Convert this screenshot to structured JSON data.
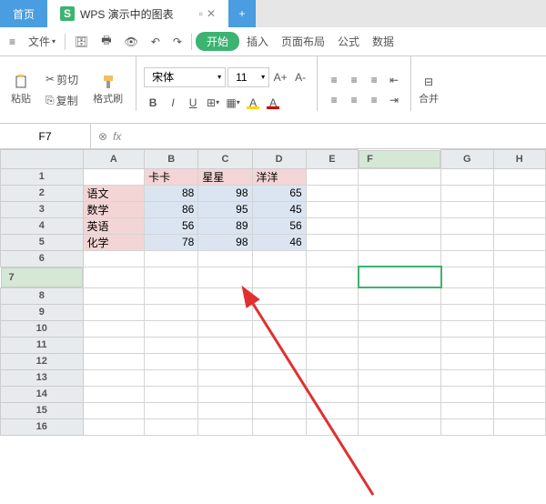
{
  "tabs": {
    "home": "首页",
    "badge": "S",
    "doc": "WPS 演示中的图表",
    "plus": "+"
  },
  "menu": {
    "file": "文件",
    "start": "开始",
    "insert": "插入",
    "layout": "页面布局",
    "formula": "公式",
    "data": "数据",
    "merge": "合并"
  },
  "clipboard": {
    "paste": "粘贴",
    "cut": "剪切",
    "copy": "复制",
    "format": "格式刷"
  },
  "font": {
    "name": "宋体",
    "size": "11",
    "bold": "B",
    "italic": "I",
    "underline": "U"
  },
  "namebox": {
    "ref": "F7",
    "fx": "fx"
  },
  "cols": [
    "A",
    "B",
    "C",
    "D",
    "E",
    "F",
    "G",
    "H"
  ],
  "rows": [
    "1",
    "2",
    "3",
    "4",
    "5",
    "6",
    "7",
    "8",
    "9",
    "10",
    "11",
    "12",
    "13",
    "14",
    "15",
    "16"
  ],
  "data": {
    "headers": [
      "卡卡",
      "星星",
      "洋洋"
    ],
    "rowlabels": [
      "语文",
      "数学",
      "英语",
      "化学"
    ],
    "values": [
      [
        88,
        98,
        65
      ],
      [
        86,
        95,
        45
      ],
      [
        56,
        89,
        56
      ],
      [
        78,
        98,
        46
      ]
    ]
  },
  "chart_data": {
    "type": "table",
    "categories": [
      "语文",
      "数学",
      "英语",
      "化学"
    ],
    "series": [
      {
        "name": "卡卡",
        "values": [
          88,
          86,
          56,
          78
        ]
      },
      {
        "name": "星星",
        "values": [
          98,
          95,
          89,
          98
        ]
      },
      {
        "name": "洋洋",
        "values": [
          65,
          45,
          56,
          46
        ]
      }
    ]
  },
  "active_cell": "F7"
}
